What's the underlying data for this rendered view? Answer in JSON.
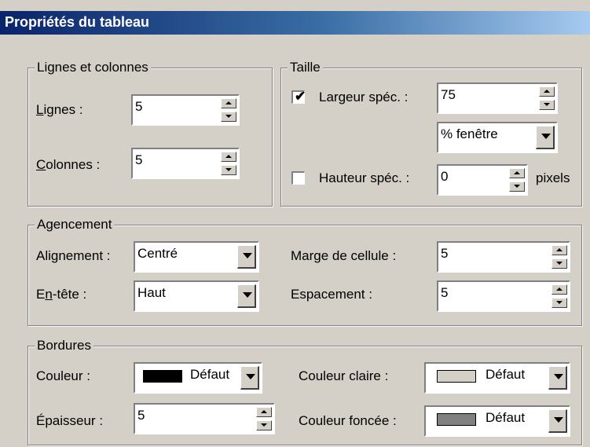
{
  "dialog": {
    "title": "Propriétés du tableau"
  },
  "rows_cols": {
    "legend": "Lignes et colonnes",
    "rows_label_u": "L",
    "rows_label_rest": "ignes :",
    "rows_value": "5",
    "cols_label_u": "C",
    "cols_label_rest": "olonnes :",
    "cols_value": "5"
  },
  "size": {
    "legend": "Taille",
    "width_checked": true,
    "width_label": "Largeur spéc. :",
    "width_value": "75",
    "width_unit": "% fenêtre",
    "height_checked": false,
    "height_label": "Hauteur spéc. :",
    "height_value": "0",
    "height_unit": "pixels"
  },
  "layout": {
    "legend": "Agencement",
    "align_label": "Alignement :",
    "align_value": "Centré",
    "header_label_pre": "E",
    "header_label_u": "n",
    "header_label_post": "-tête :",
    "header_value": "Haut",
    "padding_label": "Marge de cellule :",
    "padding_value": "5",
    "spacing_label": "Espacement :",
    "spacing_value": "5"
  },
  "borders": {
    "legend": "Bordures",
    "color_label": "Couleur :",
    "color_value": "Défaut",
    "color_swatch": "#000000",
    "thickness_label": "Épaisseur :",
    "thickness_value": "5",
    "light_label": "Couleur claire :",
    "light_value": "Défaut",
    "light_swatch": "#d4d0c8",
    "dark_label": "Couleur foncée :",
    "dark_value": "Défaut",
    "dark_swatch": "#808080"
  }
}
